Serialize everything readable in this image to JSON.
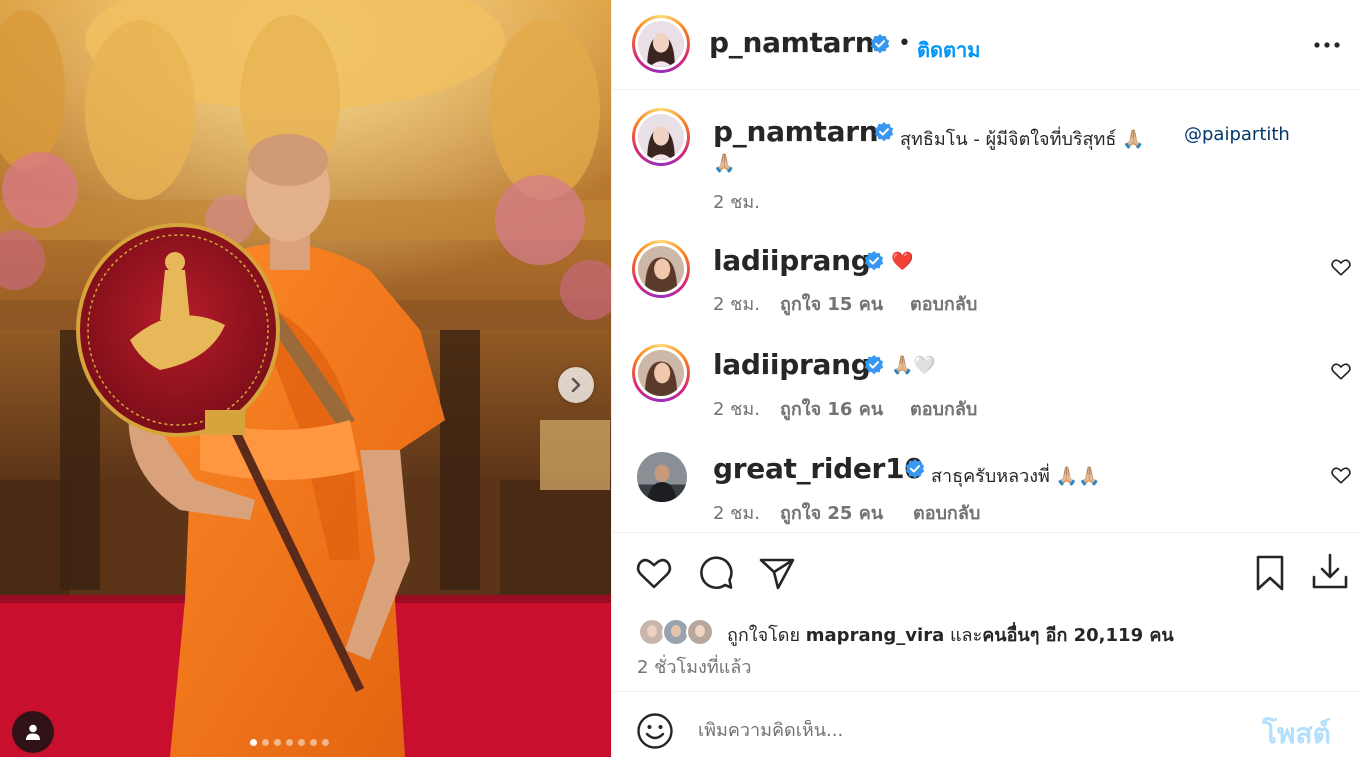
{
  "post": {
    "author": "p_namtarn",
    "follow_label": "ติดตาม",
    "bullet": "•",
    "carousel": {
      "dot_count": 7,
      "active_index": 0
    }
  },
  "caption": {
    "username": "p_namtarn",
    "text": "สุทธิมโน - ผู้มีจิตใจที่บริสุทธ์ 🙏🏼",
    "mention": "@paipartith",
    "text2": "🙏🏼",
    "time": "2 ชม."
  },
  "comments": [
    {
      "username": "ladiiprang",
      "text": "❤️",
      "time": "2 ชม.",
      "likes": "ถูกใจ 15 คน",
      "reply": "ตอบกลับ"
    },
    {
      "username": "ladiiprang",
      "text": "🙏🏼🤍",
      "time": "2 ชม.",
      "likes": "ถูกใจ 16 คน",
      "reply": "ตอบกลับ"
    },
    {
      "username": "great_rider10",
      "text": "สาธุครับหลวงพี่ 🙏🏼🙏🏼",
      "time": "2 ชม.",
      "likes": "ถูกใจ 25 คน",
      "reply": "ตอบกลับ"
    }
  ],
  "likes": {
    "prefix": "ถูกใจโดย",
    "user": "maprang_vira",
    "connector": "และ",
    "others": "คนอื่นๆ อีก 20,119 คน"
  },
  "time_ago": "2 ชั่วโมงที่แล้ว",
  "comment_box": {
    "placeholder": "เพิ่มความคิดเห็น...",
    "post_label": "โพสต์"
  },
  "colors": {
    "accent": "#0095f6",
    "verified": "#3897f0",
    "robe": "#f47a1f",
    "carpet": "#c8102e"
  },
  "icons": [
    "next-arrow-icon",
    "user-tag-icon",
    "more-options-icon",
    "verified-icon",
    "heart-icon",
    "comment-icon",
    "share-icon",
    "bookmark-icon",
    "download-icon",
    "emoji-icon"
  ]
}
